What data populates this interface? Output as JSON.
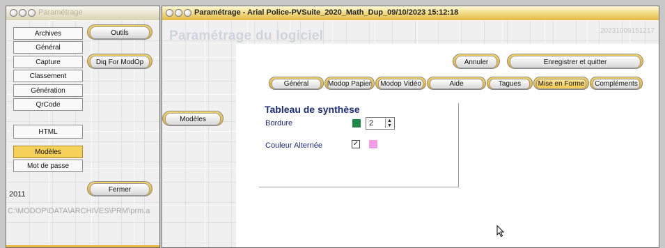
{
  "left_window": {
    "title": "Paramétrage",
    "nav_items": [
      {
        "label": "Archives",
        "selected": false
      },
      {
        "label": "Général",
        "selected": false
      },
      {
        "label": "Capture",
        "selected": false
      },
      {
        "label": "Classement",
        "selected": false
      },
      {
        "label": "Génération",
        "selected": false
      },
      {
        "label": "QrCode",
        "selected": false
      },
      {
        "label": "HTML",
        "selected": false
      },
      {
        "label": "Modèles",
        "selected": true
      },
      {
        "label": "Mot de passe",
        "selected": false
      }
    ],
    "outils_label": "Outils",
    "diq_label": "Diq For ModOp",
    "fermer_label": "Fermer",
    "year": "2011",
    "path": "C:\\MODOP\\DATA\\ARCHIVES\\PRM\\prm.a"
  },
  "right_window": {
    "title": "Paramétrage - Arial Police-PVSuite_2020_Math_Dup_09/10/2023 15:12:18",
    "heading": "Paramétrage du logiciel",
    "stamp": "20231009151217",
    "modeles_label": "Modèles",
    "annuler_label": "Annuler",
    "save_label": "Enregistrer et quitter",
    "tabs": [
      {
        "label": "Général",
        "active": false
      },
      {
        "label": "Modop Papier",
        "active": false
      },
      {
        "label": "Modop Vidéo",
        "active": false
      },
      {
        "label": "Aide",
        "active": false
      },
      {
        "label": "Tagues",
        "active": false
      },
      {
        "label": "Mise en Forme",
        "active": true
      },
      {
        "label": "Compléments",
        "active": false
      }
    ],
    "section": {
      "title": "Tableau de synthèse",
      "bordure_label": "Bordure",
      "bordure_color": "#1f8a4c",
      "bordure_value": "2",
      "alt_label": "Couleur Alternée",
      "alt_checked": true,
      "alt_color": "#f39ce8"
    }
  },
  "colors": {
    "accent_gold": "#e8b73c",
    "title_blue": "#1b2a7a"
  }
}
